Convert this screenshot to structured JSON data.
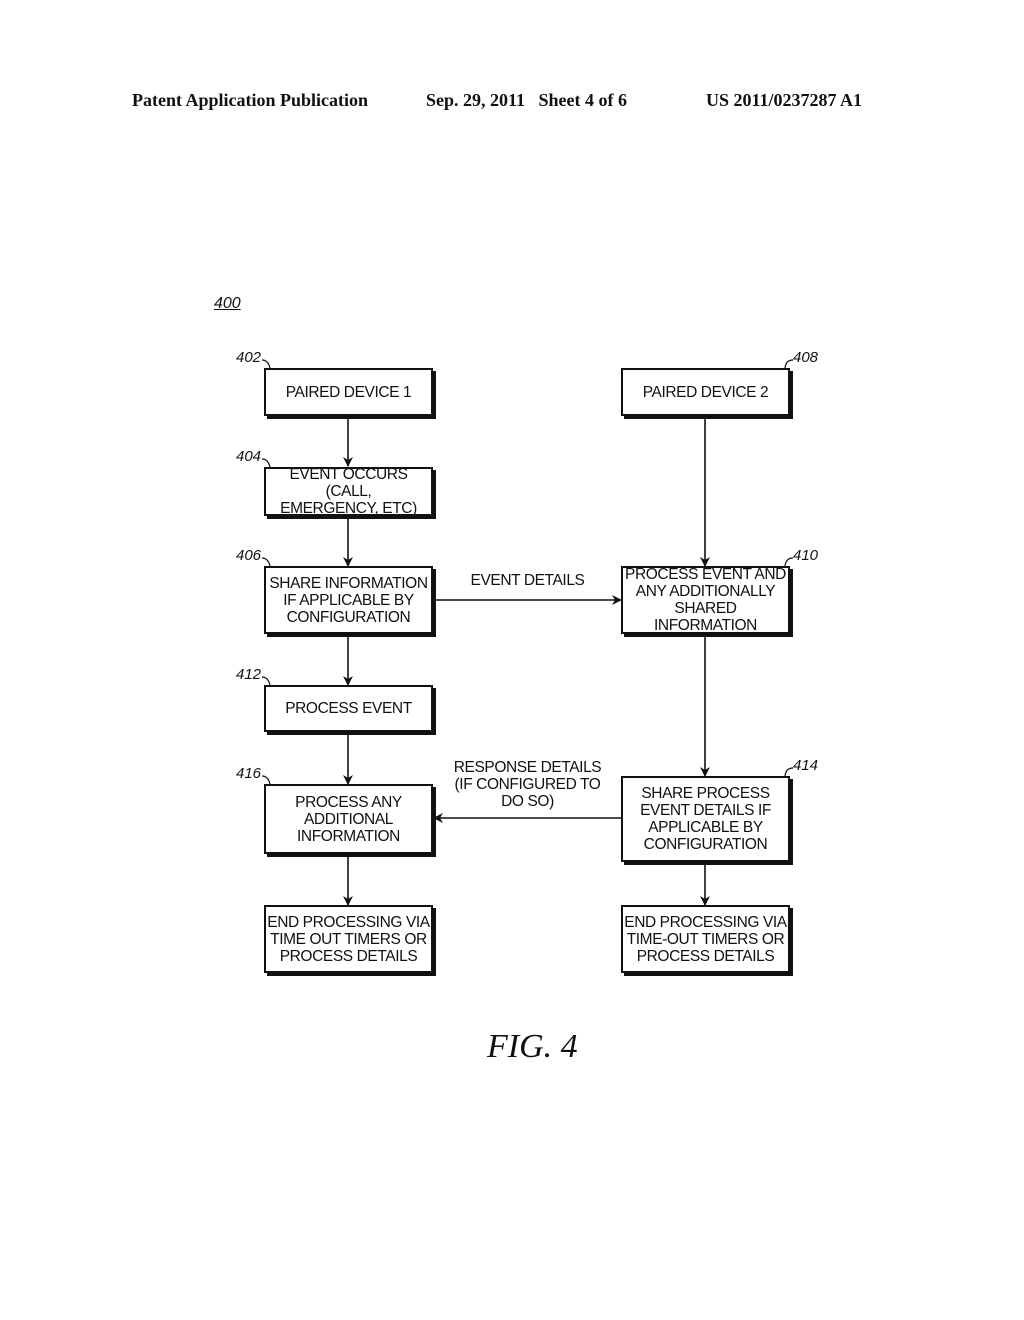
{
  "header": {
    "publication": "Patent Application Publication",
    "date_sheet": "Sep. 29, 2011   Sheet 4 of 6",
    "patent_number": "US 2011/0237287 A1"
  },
  "figure": {
    "reference": "400",
    "caption": "FIG. 4"
  },
  "nodes": [
    {
      "id": "402",
      "ref": "402",
      "text": "PAIRED DEVICE 1"
    },
    {
      "id": "404",
      "ref": "404",
      "text": "EVENT OCCURS (CALL,\nEMERGENCY, ETC)"
    },
    {
      "id": "406",
      "ref": "406",
      "text": "SHARE INFORMATION\nIF APPLICABLE BY\nCONFIGURATION"
    },
    {
      "id": "412",
      "ref": "412",
      "text": "PROCESS EVENT"
    },
    {
      "id": "416",
      "ref": "416",
      "text": "PROCESS ANY\nADDITIONAL\nINFORMATION"
    },
    {
      "id": "end-left",
      "ref": "",
      "text": "END PROCESSING VIA\nTIME OUT TIMERS OR\nPROCESS DETAILS"
    },
    {
      "id": "408",
      "ref": "408",
      "text": "PAIRED DEVICE 2"
    },
    {
      "id": "410",
      "ref": "410",
      "text": "PROCESS EVENT AND\nANY ADDITIONALLY\nSHARED INFORMATION"
    },
    {
      "id": "414",
      "ref": "414",
      "text": "SHARE PROCESS\nEVENT DETAILS IF\nAPPLICABLE BY\nCONFIGURATION"
    },
    {
      "id": "end-right",
      "ref": "",
      "text": "END PROCESSING VIA\nTIME-OUT TIMERS OR\nPROCESS DETAILS"
    }
  ],
  "edges": [
    {
      "from": "402",
      "to": "404",
      "label": ""
    },
    {
      "from": "404",
      "to": "406",
      "label": ""
    },
    {
      "from": "406",
      "to": "412",
      "label": ""
    },
    {
      "from": "412",
      "to": "416",
      "label": ""
    },
    {
      "from": "416",
      "to": "end-left",
      "label": ""
    },
    {
      "from": "408",
      "to": "410",
      "label": ""
    },
    {
      "from": "410",
      "to": "414",
      "label": ""
    },
    {
      "from": "414",
      "to": "end-right",
      "label": ""
    },
    {
      "from": "406",
      "to": "410",
      "label": "EVENT DETAILS"
    },
    {
      "from": "414",
      "to": "416",
      "label": "RESPONSE DETAILS\n(IF CONFIGURED TO\nDO SO)"
    }
  ]
}
